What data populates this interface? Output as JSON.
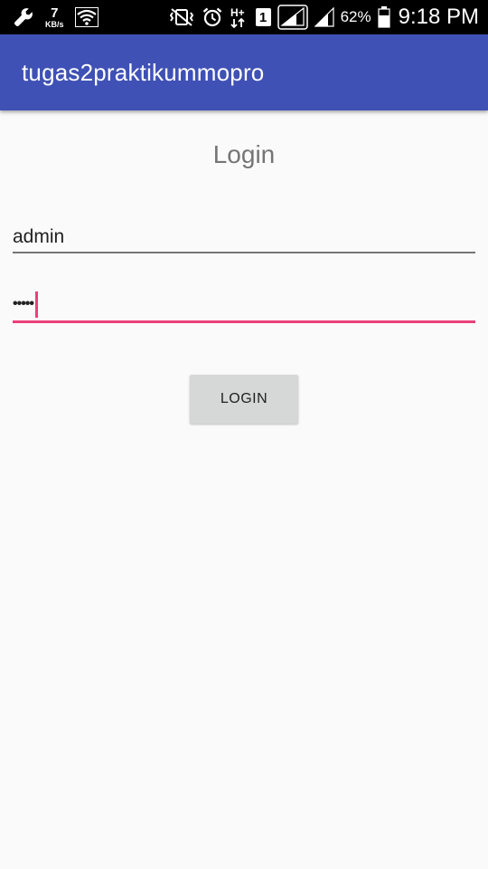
{
  "status_bar": {
    "net_speed_value": "7",
    "net_speed_unit": "KB/s",
    "sim_slot": "1",
    "network_type": "H+",
    "battery_percent": "62%",
    "time": "9:18 PM",
    "icons": [
      "wrench-icon",
      "wifi-icon",
      "vibrate-mute-icon",
      "alarm-icon",
      "hplus-data-icon",
      "sim1-icon",
      "signal-icon",
      "signal-icon",
      "battery-icon"
    ]
  },
  "app_bar": {
    "title": "tugas2praktikummopro",
    "color": "#3f51b5"
  },
  "login": {
    "heading": "Login",
    "username_value": "admin",
    "password_value": "•••••",
    "button_label": "LOGIN",
    "accent_color": "#ec407a"
  }
}
